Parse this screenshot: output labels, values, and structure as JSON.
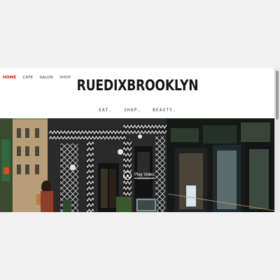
{
  "nav": {
    "items": [
      "HOME",
      "CAFE",
      "SALON",
      "SHOP"
    ],
    "active": "HOME"
  },
  "brand": {
    "title": "RUEDIXBROOKLYN"
  },
  "tagline": {
    "items": [
      "EAT.",
      "SHOP.",
      "BEAUTY."
    ]
  },
  "hero": {
    "play_label": "Play Video"
  },
  "colors": {
    "accent": "#d10c0c",
    "page_bg": "#f1f1f1",
    "header_bg": "#ffffff"
  }
}
